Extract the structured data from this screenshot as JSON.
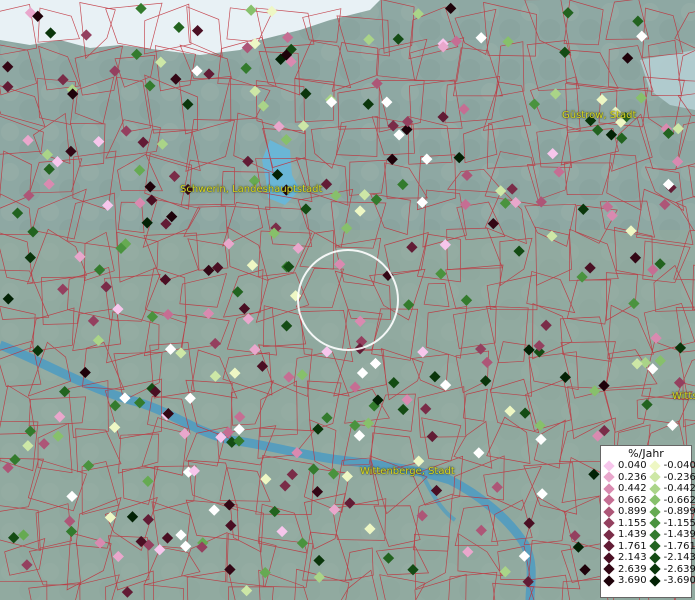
{
  "map": {
    "cities": [
      {
        "label": "Schwerin, Landeshauptstadt"
      },
      {
        "label": "Güstrow, Stadt"
      },
      {
        "label": "Wittenberge, Stadt"
      },
      {
        "label": "Witts"
      }
    ]
  },
  "legend": {
    "title": "%/Jahr",
    "positive": [
      {
        "value": "0.040",
        "color": "#f7c6ec"
      },
      {
        "value": "0.236",
        "color": "#e9a7cc"
      },
      {
        "value": "0.442",
        "color": "#d98ab0"
      },
      {
        "value": "0.662",
        "color": "#c56e93"
      },
      {
        "value": "0.899",
        "color": "#ad5677"
      },
      {
        "value": "1.155",
        "color": "#94405f"
      },
      {
        "value": "1.439",
        "color": "#7a2c48"
      },
      {
        "value": "1.761",
        "color": "#621c35"
      },
      {
        "value": "2.143",
        "color": "#4a0f23"
      },
      {
        "value": "2.639",
        "color": "#330715"
      },
      {
        "value": "3.690",
        "color": "#1e020a"
      }
    ],
    "negative": [
      {
        "value": "-0.040",
        "color": "#eef7c4"
      },
      {
        "value": "-0.236",
        "color": "#cde7a6"
      },
      {
        "value": "-0.442",
        "color": "#aad488"
      },
      {
        "value": "-0.662",
        "color": "#87c06b"
      },
      {
        "value": "-0.899",
        "color": "#66aa52"
      },
      {
        "value": "-1.155",
        "color": "#4a933e"
      },
      {
        "value": "-1.439",
        "color": "#337b2d"
      },
      {
        "value": "-1.761",
        "color": "#22631f"
      },
      {
        "value": "-2.143",
        "color": "#144c14"
      },
      {
        "value": "-2.639",
        "color": "#0a360b"
      },
      {
        "value": "-3.690",
        "color": "#032205"
      }
    ]
  }
}
